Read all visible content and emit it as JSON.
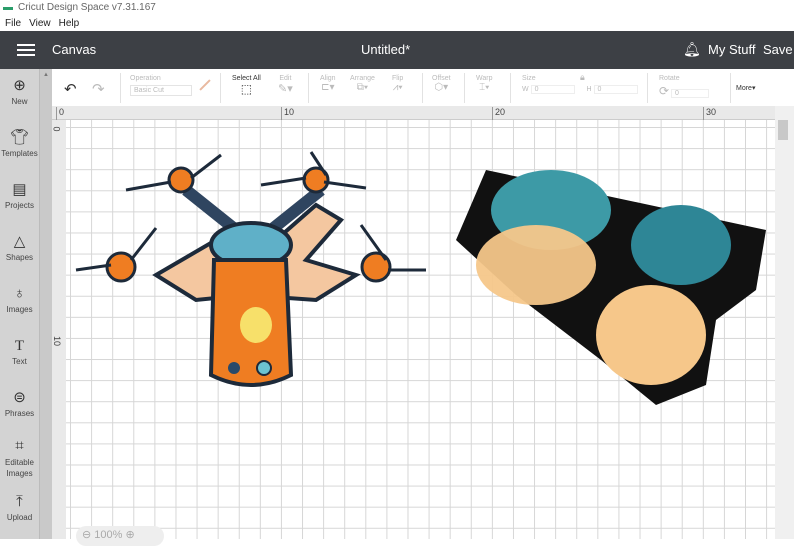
{
  "app": {
    "title": "Cricut Design Space  v7.31.167"
  },
  "menu": [
    "File",
    "View",
    "Help"
  ],
  "header": {
    "section": "Canvas",
    "doc_title": "Untitled*",
    "my_stuff": "My Stuff",
    "save": "Save"
  },
  "sidebar": [
    {
      "label": "New",
      "icon": "plus-circle-icon"
    },
    {
      "label": "Templates",
      "icon": "shirt-icon"
    },
    {
      "label": "Projects",
      "icon": "projects-icon"
    },
    {
      "label": "Shapes",
      "icon": "shapes-icon"
    },
    {
      "label": "Images",
      "icon": "balloon-icon"
    },
    {
      "label": "Text",
      "icon": "text-icon"
    },
    {
      "label": "Phrases",
      "icon": "speech-bubble-icon"
    },
    {
      "label": "Editable Images",
      "icon": "editable-images-icon"
    },
    {
      "label": "Upload",
      "icon": "upload-icon"
    }
  ],
  "toolbar": {
    "operation_label": "Operation",
    "operation_value": "Basic Cut",
    "select_all": "Select All",
    "edit": "Edit",
    "align": "Align",
    "arrange": "Arrange",
    "flip": "Flip",
    "offset": "Offset",
    "warp": "Warp",
    "size": "Size",
    "w_label": "W",
    "w_value": "0",
    "h_label": "H",
    "h_value": "0",
    "rotate": "Rotate",
    "rotate_value": "0",
    "more": "More▾"
  },
  "ruler": {
    "top": [
      "0",
      "10",
      "20",
      "30"
    ],
    "left": [
      "0",
      "10"
    ]
  },
  "zoom": {
    "value": "100%"
  }
}
